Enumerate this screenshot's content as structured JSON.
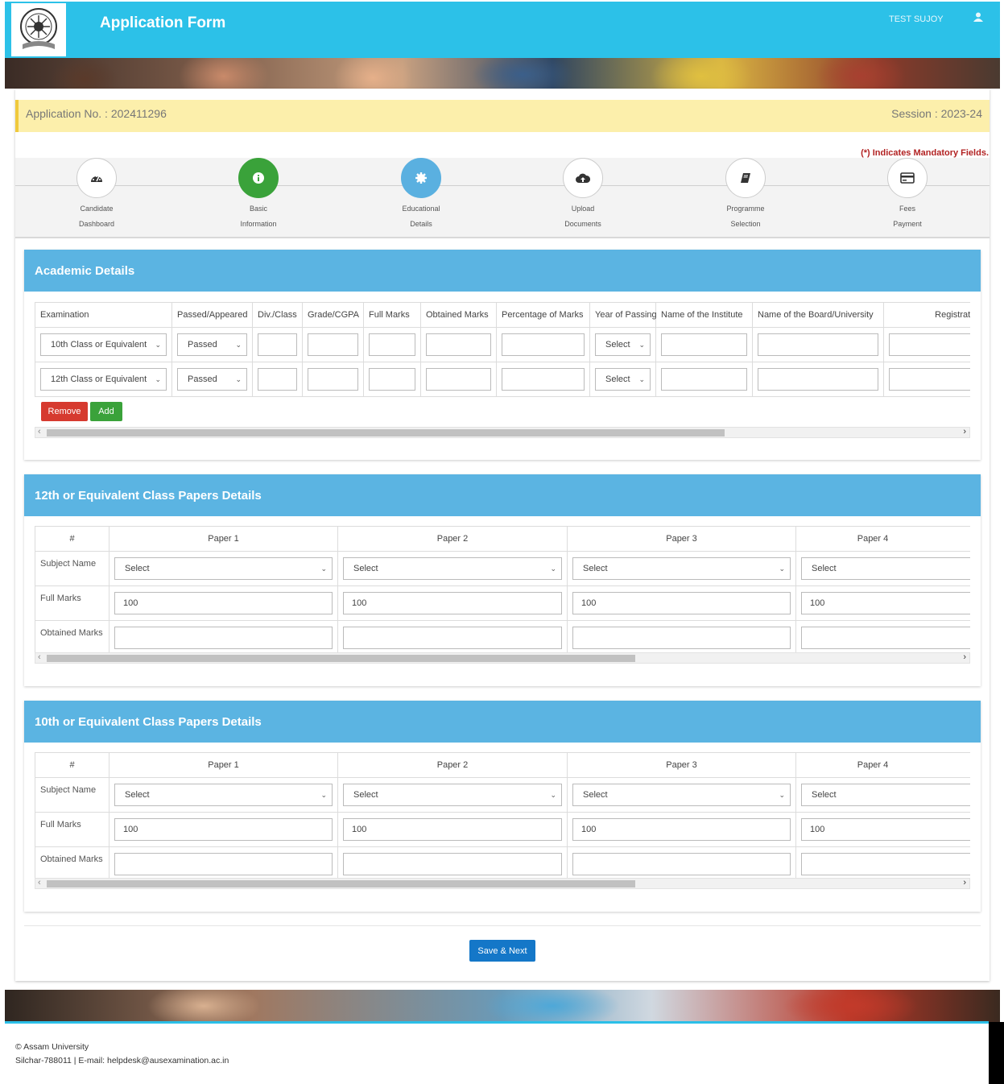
{
  "header": {
    "title": "Application Form",
    "user": "TEST SUJOY"
  },
  "application": {
    "number": "Application No. : 202411296",
    "session": "Session : 2023-24"
  },
  "mandatory_note": "(*) Indicates Mandatory Fields.",
  "steps": [
    {
      "label": "Candidate\nDashboard",
      "icon": "dashboard-icon",
      "state": "default"
    },
    {
      "label": "Basic\nInformation",
      "icon": "info-icon",
      "state": "completed"
    },
    {
      "label": "Educational\nDetails",
      "icon": "gear-icon",
      "state": "active"
    },
    {
      "label": "Upload\nDocuments",
      "icon": "cloud-upload-icon",
      "state": "default"
    },
    {
      "label": "Programme\nSelection",
      "icon": "book-icon",
      "state": "default"
    },
    {
      "label": "Fees\nPayment",
      "icon": "credit-card-icon",
      "state": "default"
    }
  ],
  "academic": {
    "title": "Academic Details",
    "columns": [
      "Examination",
      "Passed/Appeared",
      "Div./Class",
      "Grade/CGPA",
      "Full Marks",
      "Obtained Marks",
      "Percentage of Marks",
      "Year of Passing",
      "Name of the Institute",
      "Name of the Board/University",
      "Registration"
    ],
    "rows": [
      {
        "examination": "10th Class or Equivalent",
        "status": "Passed",
        "year": "Select"
      },
      {
        "examination": "12th Class or Equivalent",
        "status": "Passed",
        "year": "Select"
      }
    ],
    "remove_label": "Remove",
    "add_label": "Add"
  },
  "papers12": {
    "title": "12th or Equivalent Class Papers Details",
    "hash": "#",
    "papers": [
      "Paper 1",
      "Paper 2",
      "Paper 3",
      "Paper 4"
    ],
    "row_labels": [
      "Subject Name",
      "Full Marks",
      "Obtained Marks"
    ],
    "subject_default": "Select",
    "full_marks": [
      "100",
      "100",
      "100",
      "100"
    ]
  },
  "papers10": {
    "title": "10th or Equivalent Class Papers Details",
    "hash": "#",
    "papers": [
      "Paper 1",
      "Paper 2",
      "Paper 3",
      "Paper 4"
    ],
    "row_labels": [
      "Subject Name",
      "Full Marks",
      "Obtained Marks"
    ],
    "subject_default": "Select",
    "full_marks": [
      "100",
      "100",
      "100",
      "100"
    ]
  },
  "save_label": "Save & Next",
  "footer": {
    "line1": "© Assam University",
    "line2": "Silchar-788011 | E-mail: helpdesk@ausexamination.ac.in"
  }
}
